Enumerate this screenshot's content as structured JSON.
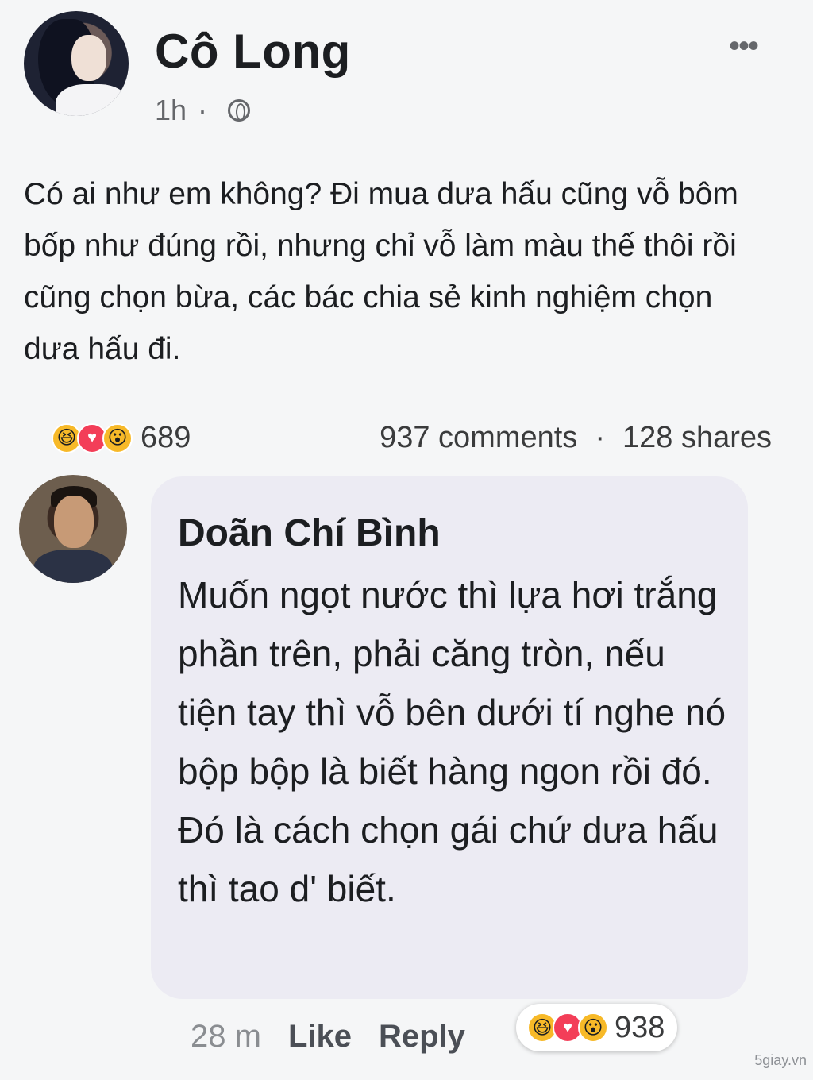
{
  "post": {
    "author": "Cô Long",
    "time": "1h",
    "separator": "·",
    "more_glyph": "•••",
    "text": "Có ai như em không? Đi mua dưa hấu cũng vỗ bôm bốp như đúng rồi, nhưng chỉ vỗ làm màu thế thôi rồi cũng chọn bừa, các bác chia sẻ kinh nghiệm chọn dưa hấu đi.",
    "reaction_count": "689",
    "comments": "937 comments",
    "stats_separator": "·",
    "shares": "128 shares"
  },
  "comment": {
    "author": "Doãn Chí Bình",
    "text": "Muốn ngọt nước thì lựa hơi trắng phần trên, phải căng tròn, nếu tiện tay thì vỗ bên dưới tí nghe nó bộp bộp là biết hàng ngon rồi đó. Đó là cách chọn gái chứ dưa hấu thì tao d' biết.",
    "time": "28 m",
    "like_label": "Like",
    "reply_label": "Reply",
    "reaction_count": "938"
  },
  "reaction_icons": [
    "haha-icon",
    "love-icon",
    "wow-icon"
  ],
  "colors": {
    "bubble": "#ecebf3",
    "haha": "#f7b928",
    "love": "#f33e58",
    "secondary_text": "#65676b"
  },
  "watermark": "5giay.vn"
}
